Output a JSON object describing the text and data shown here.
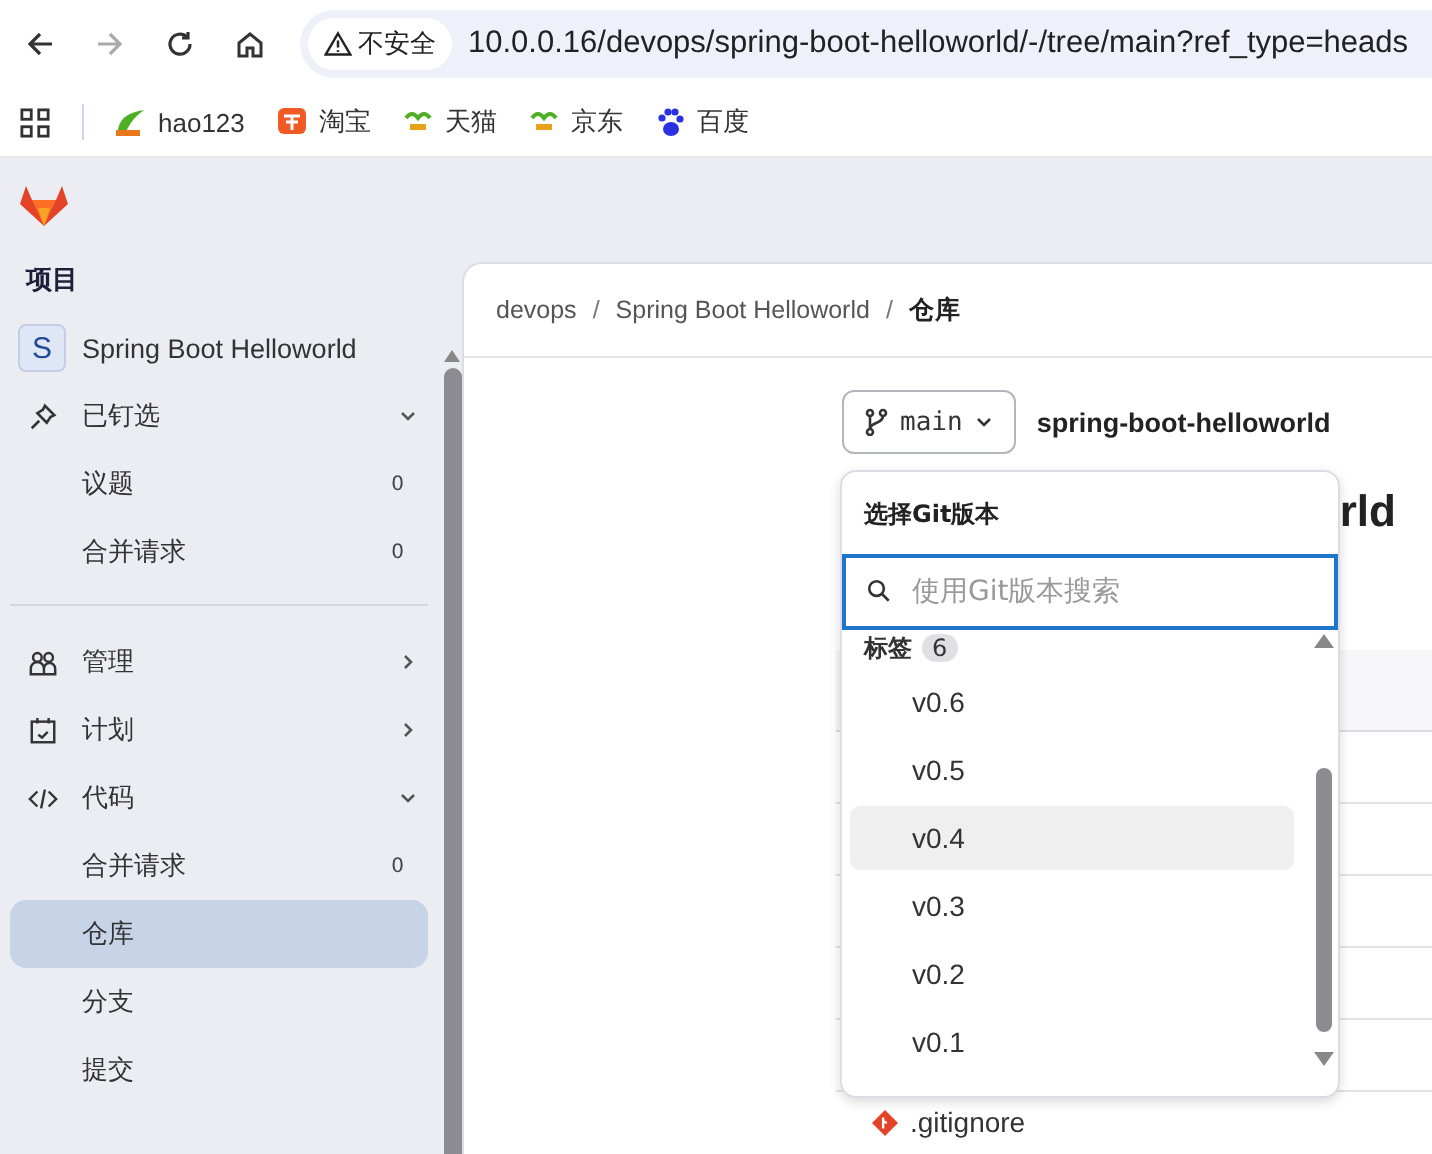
{
  "browser": {
    "security_label": "不安全",
    "url": "10.0.0.16/devops/spring-boot-helloworld/-/tree/main?ref_type=heads",
    "bookmarks": [
      {
        "label": "hao123",
        "kind": "leaf"
      },
      {
        "label": "淘宝",
        "kind": "tao"
      },
      {
        "label": "天猫",
        "kind": "hao"
      },
      {
        "label": "京东",
        "kind": "hao"
      },
      {
        "label": "百度",
        "kind": "paw"
      }
    ]
  },
  "sidebar": {
    "section_title": "项目",
    "project": {
      "initial": "S",
      "name": "Spring Boot Helloworld"
    },
    "groups": [
      {
        "label": "已钉选",
        "kind": "pin",
        "expanded": true,
        "children": [
          {
            "label": "议题",
            "count": "0",
            "selected": false
          },
          {
            "label": "合并请求",
            "count": "0",
            "selected": false
          }
        ]
      },
      {
        "label": "管理",
        "kind": "people",
        "expanded": false
      },
      {
        "label": "计划",
        "kind": "calendar",
        "expanded": false
      },
      {
        "label": "代码",
        "kind": "code",
        "expanded": true,
        "children": [
          {
            "label": "合并请求",
            "count": "0",
            "selected": false
          },
          {
            "label": "仓库",
            "selected": true
          },
          {
            "label": "分支",
            "selected": false
          },
          {
            "label": "提交",
            "selected": false
          }
        ]
      }
    ]
  },
  "breadcrumb_separator": "/",
  "breadcrumbs": [
    {
      "label": "devops"
    },
    {
      "label": "Spring Boot Helloworld"
    },
    {
      "label": "仓库"
    }
  ],
  "branch_button": "main",
  "repo_name": "spring-boot-helloworld",
  "heading": "rld",
  "dropdown": {
    "title": "选择Git版本",
    "search_placeholder": "使用Git版本搜索",
    "section": {
      "label": "标签",
      "count": "6"
    },
    "items": [
      {
        "label": "v0.6",
        "highlighted": false
      },
      {
        "label": "v0.5",
        "highlighted": false
      },
      {
        "label": "v0.4",
        "highlighted": true
      },
      {
        "label": "v0.3",
        "highlighted": false
      },
      {
        "label": "v0.2",
        "highlighted": false
      },
      {
        "label": "v0.1",
        "highlighted": false
      }
    ]
  },
  "files": [
    {
      "name": ".gitignore"
    }
  ]
}
